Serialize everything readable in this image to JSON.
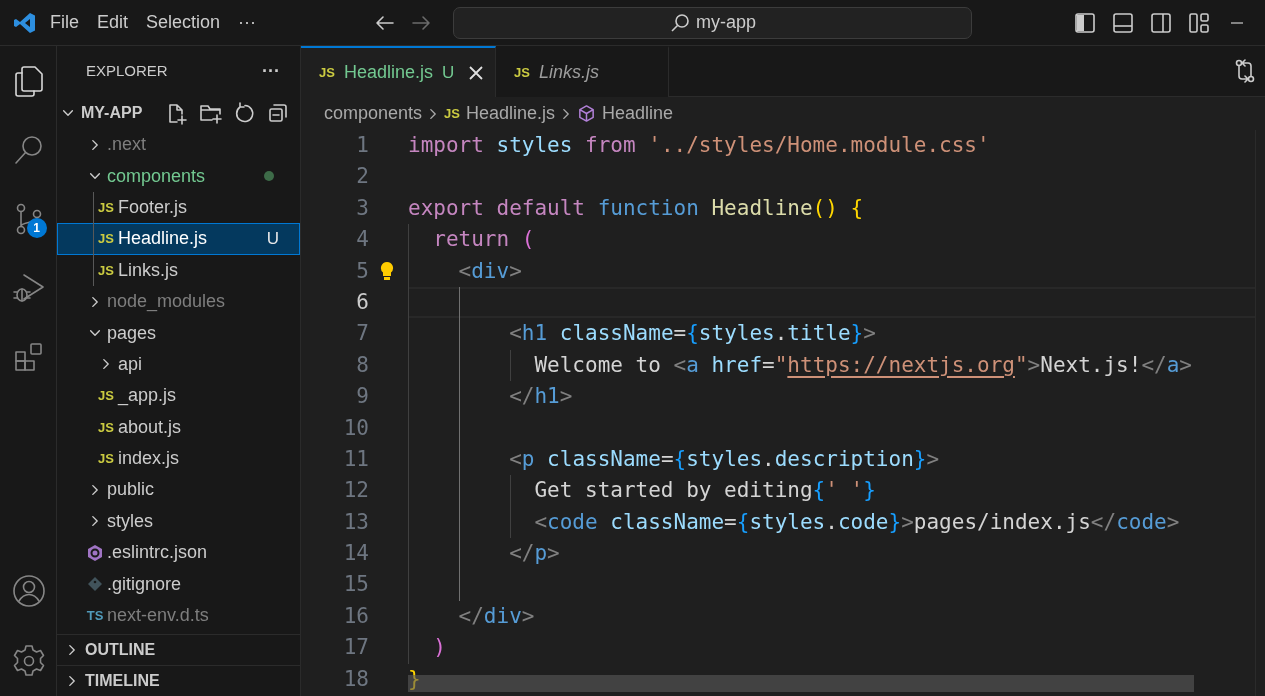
{
  "title_bar": {
    "menus": [
      "File",
      "Edit",
      "Selection",
      "···"
    ],
    "search": {
      "value": "my-app"
    }
  },
  "activity_bar": {
    "items": [
      {
        "kind": "files",
        "selected": true
      },
      {
        "kind": "search",
        "selected": false
      },
      {
        "kind": "source-control",
        "selected": false,
        "badge": "1"
      },
      {
        "kind": "run-debug",
        "selected": false
      },
      {
        "kind": "extensions",
        "selected": false
      }
    ],
    "bottom": [
      {
        "kind": "account"
      },
      {
        "kind": "settings"
      }
    ]
  },
  "sidebar": {
    "title": "EXPLORER",
    "more": "···",
    "folder": {
      "name": "MY-APP",
      "expanded": true,
      "items": [
        {
          "name": ".next",
          "kind": "folder",
          "expanded": false,
          "selected": false,
          "ignored": true,
          "untracked": false
        },
        {
          "name": "components",
          "kind": "folder",
          "expanded": true,
          "selected": false,
          "ignored": false,
          "untracked": true,
          "children": [
            {
              "name": "Footer.js",
              "kind": "js",
              "icon": "JS",
              "selected": false,
              "ignored": false,
              "untracked": false
            },
            {
              "name": "Headline.js",
              "kind": "js",
              "icon": "JS",
              "selected": true,
              "ignored": false,
              "untracked": true,
              "badge": "U"
            },
            {
              "name": "Links.js",
              "kind": "js",
              "icon": "JS",
              "selected": false,
              "ignored": false,
              "untracked": false
            }
          ]
        },
        {
          "name": "node_modules",
          "kind": "folder",
          "expanded": false,
          "selected": false,
          "ignored": true,
          "untracked": false
        },
        {
          "name": "pages",
          "kind": "folder",
          "expanded": true,
          "selected": false,
          "ignored": false,
          "untracked": false,
          "children": [
            {
              "name": "api",
              "kind": "folder",
              "expanded": false,
              "selected": false,
              "ignored": false,
              "untracked": false
            },
            {
              "name": "_app.js",
              "kind": "js",
              "icon": "JS",
              "selected": false,
              "ignored": false,
              "untracked": false
            },
            {
              "name": "about.js",
              "kind": "js",
              "icon": "JS",
              "selected": false,
              "ignored": false,
              "untracked": false
            },
            {
              "name": "index.js",
              "kind": "js",
              "icon": "JS",
              "selected": false,
              "ignored": false,
              "untracked": false
            }
          ]
        },
        {
          "name": "public",
          "kind": "folder",
          "expanded": false,
          "selected": false,
          "ignored": false,
          "untracked": false
        },
        {
          "name": "styles",
          "kind": "folder",
          "expanded": false,
          "selected": false,
          "ignored": false,
          "untracked": false
        },
        {
          "name": ".eslintrc.json",
          "kind": "eslint",
          "selected": false,
          "ignored": false,
          "untracked": false
        },
        {
          "name": ".gitignore",
          "kind": "git",
          "selected": false,
          "ignored": false,
          "untracked": false
        },
        {
          "name": "next-env.d.ts",
          "kind": "ts",
          "icon": "TS",
          "selected": false,
          "ignored": true,
          "untracked": false
        }
      ]
    },
    "sections": [
      {
        "title": "OUTLINE",
        "expanded": false
      },
      {
        "title": "TIMELINE",
        "expanded": false
      }
    ]
  },
  "editor": {
    "tabs": [
      {
        "name": "Headline.js",
        "icon": "JS",
        "selected": true,
        "preview": false,
        "untracked": true,
        "badge": "U"
      },
      {
        "name": "Links.js",
        "icon": "JS",
        "selected": false,
        "preview": true,
        "untracked": false
      }
    ],
    "breadcrumbs": [
      {
        "text": "components",
        "kind": "folder"
      },
      {
        "text": "Headline.js",
        "kind": "js",
        "icon": "JS"
      },
      {
        "text": "Headline",
        "kind": "symbol"
      }
    ],
    "lines": [
      {
        "number": "1",
        "current": false,
        "lightbulb": false,
        "tokens": [
          {
            "text": "import",
            "kind": "keyword"
          },
          {
            "text": " styles",
            "kind": "variable"
          },
          {
            "text": " from",
            "kind": "keyword"
          },
          {
            "text": " '../styles/Home.module.css'",
            "kind": "string"
          }
        ]
      },
      {
        "number": "2",
        "current": false,
        "lightbulb": false
      },
      {
        "number": "3",
        "current": false,
        "lightbulb": false,
        "tokens": [
          {
            "text": "export",
            "kind": "keyword"
          },
          {
            "text": " default",
            "kind": "keyword"
          },
          {
            "text": " function",
            "kind": "tag"
          },
          {
            "text": " Headline",
            "kind": "function"
          },
          {
            "text": "() {",
            "kind": "bracket1"
          }
        ]
      },
      {
        "number": "4",
        "current": false,
        "lightbulb": false,
        "tokens": [
          {
            "text": "  return",
            "kind": "keyword"
          },
          {
            "text": " (",
            "kind": "bracket2"
          }
        ]
      },
      {
        "number": "5",
        "current": false,
        "lightbulb": true,
        "tokens": [
          {
            "text": "    <",
            "kind": "punct"
          },
          {
            "text": "div",
            "kind": "tag"
          },
          {
            "text": ">",
            "kind": "punct"
          }
        ]
      },
      {
        "number": "6",
        "current": true,
        "lightbulb": false
      },
      {
        "number": "7",
        "current": false,
        "lightbulb": false,
        "tokens": [
          {
            "text": "        <",
            "kind": "punct"
          },
          {
            "text": "h1",
            "kind": "tag"
          },
          {
            "text": " className",
            "kind": "variable"
          },
          {
            "text": "=",
            "kind": "text"
          },
          {
            "text": "{",
            "kind": "bracket3"
          },
          {
            "text": "styles",
            "kind": "variable"
          },
          {
            "text": ".",
            "kind": "text"
          },
          {
            "text": "title",
            "kind": "variable"
          },
          {
            "text": "}",
            "kind": "bracket3"
          },
          {
            "text": ">",
            "kind": "punct"
          }
        ]
      },
      {
        "number": "8",
        "current": false,
        "lightbulb": false,
        "tokens": [
          {
            "text": "          Welcome to",
            "kind": "text"
          },
          {
            "text": " <",
            "kind": "punct"
          },
          {
            "text": "a",
            "kind": "tag"
          },
          {
            "text": " href",
            "kind": "variable"
          },
          {
            "text": "=",
            "kind": "text"
          },
          {
            "text": "\"",
            "kind": "string"
          },
          {
            "text": "https://nextjs.org",
            "kind": "link"
          },
          {
            "text": "\"",
            "kind": "string"
          },
          {
            "text": ">",
            "kind": "punct"
          },
          {
            "text": "Next.js!",
            "kind": "text"
          },
          {
            "text": "</",
            "kind": "punct"
          },
          {
            "text": "a",
            "kind": "tag"
          },
          {
            "text": ">",
            "kind": "punct"
          }
        ]
      },
      {
        "number": "9",
        "current": false,
        "lightbulb": false,
        "tokens": [
          {
            "text": "        </",
            "kind": "punct"
          },
          {
            "text": "h1",
            "kind": "tag"
          },
          {
            "text": ">",
            "kind": "punct"
          }
        ]
      },
      {
        "number": "10",
        "current": false,
        "lightbulb": false
      },
      {
        "number": "11",
        "current": false,
        "lightbulb": false,
        "tokens": [
          {
            "text": "        <",
            "kind": "punct"
          },
          {
            "text": "p",
            "kind": "tag"
          },
          {
            "text": " className",
            "kind": "variable"
          },
          {
            "text": "=",
            "kind": "text"
          },
          {
            "text": "{",
            "kind": "bracket3"
          },
          {
            "text": "styles",
            "kind": "variable"
          },
          {
            "text": ".",
            "kind": "text"
          },
          {
            "text": "description",
            "kind": "variable"
          },
          {
            "text": "}",
            "kind": "bracket3"
          },
          {
            "text": ">",
            "kind": "punct"
          }
        ]
      },
      {
        "number": "12",
        "current": false,
        "lightbulb": false,
        "tokens": [
          {
            "text": "          Get started by editing",
            "kind": "text"
          },
          {
            "text": "{",
            "kind": "bracket3"
          },
          {
            "text": "' '",
            "kind": "string"
          },
          {
            "text": "}",
            "kind": "bracket3"
          }
        ]
      },
      {
        "number": "13",
        "current": false,
        "lightbulb": false,
        "tokens": [
          {
            "text": "          <",
            "kind": "punct"
          },
          {
            "text": "code",
            "kind": "tag"
          },
          {
            "text": " className",
            "kind": "variable"
          },
          {
            "text": "=",
            "kind": "text"
          },
          {
            "text": "{",
            "kind": "bracket3"
          },
          {
            "text": "styles",
            "kind": "variable"
          },
          {
            "text": ".",
            "kind": "text"
          },
          {
            "text": "code",
            "kind": "variable"
          },
          {
            "text": "}",
            "kind": "bracket3"
          },
          {
            "text": ">",
            "kind": "punct"
          },
          {
            "text": "pages/index.js",
            "kind": "text"
          },
          {
            "text": "</",
            "kind": "punct"
          },
          {
            "text": "code",
            "kind": "tag"
          },
          {
            "text": ">",
            "kind": "punct"
          }
        ]
      },
      {
        "number": "14",
        "current": false,
        "lightbulb": false,
        "tokens": [
          {
            "text": "        </",
            "kind": "punct"
          },
          {
            "text": "p",
            "kind": "tag"
          },
          {
            "text": ">",
            "kind": "punct"
          }
        ]
      },
      {
        "number": "15",
        "current": false,
        "lightbulb": false
      },
      {
        "number": "16",
        "current": false,
        "lightbulb": false,
        "tokens": [
          {
            "text": "    </",
            "kind": "punct"
          },
          {
            "text": "div",
            "kind": "tag"
          },
          {
            "text": ">",
            "kind": "punct"
          }
        ]
      },
      {
        "number": "17",
        "current": false,
        "lightbulb": false,
        "tokens": [
          {
            "text": "  )",
            "kind": "bracket2"
          }
        ]
      },
      {
        "number": "18",
        "current": false,
        "lightbulb": false,
        "tokens": [
          {
            "text": "}",
            "kind": "bracket1"
          }
        ]
      }
    ]
  }
}
